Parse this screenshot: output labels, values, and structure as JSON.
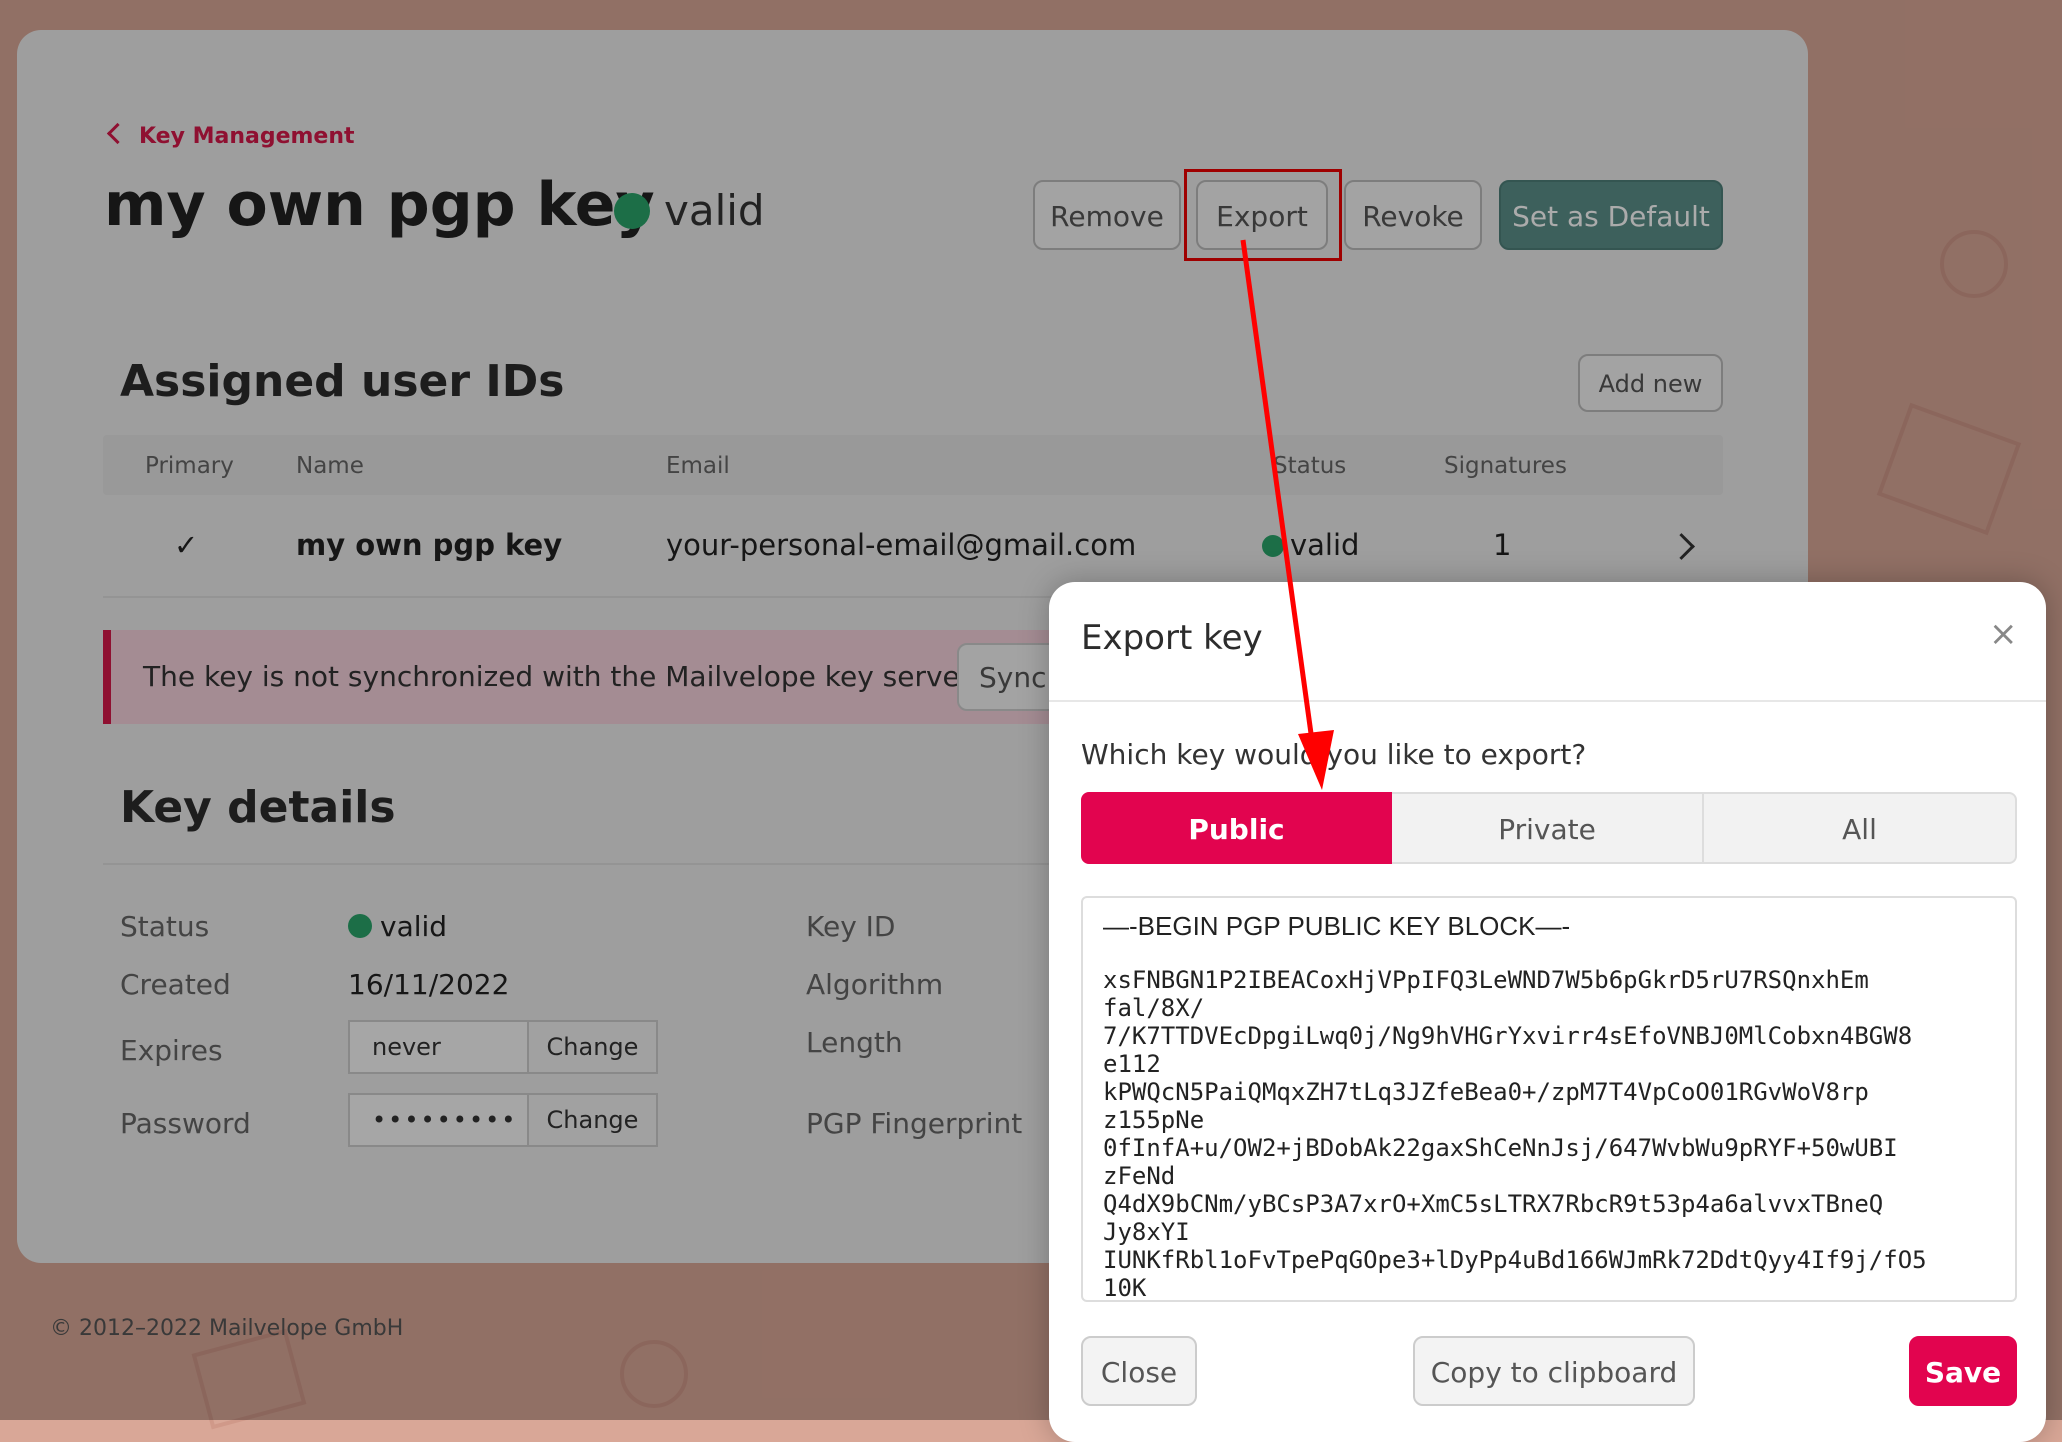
{
  "colors": {
    "accent": "#e2044f",
    "valid": "#2aa56b",
    "primary_button": "#5b8f8a",
    "annotation": "#ff0000"
  },
  "header": {
    "back_label": "Key Management",
    "title": "my own pgp key",
    "status": "valid"
  },
  "toolbar": {
    "remove": "Remove",
    "export": "Export",
    "revoke": "Revoke",
    "set_default": "Set as Default"
  },
  "user_ids": {
    "heading": "Assigned user IDs",
    "add_new": "Add new",
    "columns": [
      "Primary",
      "Name",
      "Email",
      "Status",
      "Signatures"
    ],
    "rows": [
      {
        "primary": "✓",
        "name": "my own pgp key",
        "email": "your-personal-email@gmail.com",
        "status": "valid",
        "signatures": "1"
      }
    ]
  },
  "alert": {
    "text": "The key is not synchronized with the Mailvelope key server.",
    "button": "Synch"
  },
  "details": {
    "heading": "Key details",
    "status_label": "Status",
    "status_value": "valid",
    "created_label": "Created",
    "created_value": "16/11/2022",
    "expires_label": "Expires",
    "expires_value": "never",
    "expires_change": "Change",
    "password_label": "Password",
    "password_value": "•••••••••",
    "password_change": "Change",
    "keyid_label": "Key ID",
    "algorithm_label": "Algorithm",
    "length_label": "Length",
    "fingerprint_label": "PGP Fingerprint"
  },
  "footer": {
    "copyright": "© 2012–2022  Mailvelope GmbH"
  },
  "modal": {
    "title": "Export key",
    "close_icon": "×",
    "question": "Which key would you like to export?",
    "options": [
      "Public",
      "Private",
      "All"
    ],
    "selected": "Public",
    "key_begin": "—-BEGIN PGP PUBLIC KEY BLOCK—-",
    "key_lines": [
      "xsFNBGN1P2IBEACoxHjVPpIFQ3LeWND7W5b6pGkrD5rU7RSQnxhEm",
      "fal/8X/",
      "7/K7TTDVEcDpgiLwq0j/Ng9hVHGrYxvirr4sEfoVNBJ0MlCobxn4BGW8",
      "e112",
      "kPWQcN5PaiQMqxZH7tLq3JZfeBea0+/zpM7T4VpCoO01RGvWoV8rp",
      "z155pNe",
      "0fInfA+u/OW2+jBDobAk22gaxShCeNnJsj/647WvbWu9pRYF+50wUBI",
      "zFeNd",
      "Q4dX9bCNm/yBCsP3A7xrO+XmC5sLTRX7RbcR9t53p4a6alvvxTBneQ",
      "Jy8xYI",
      "IUNKfRbl1oFvTpePqGOpe3+lDyPp4uBd166WJmRk72DdtQyy4If9j/fO5",
      "10K"
    ],
    "close_button": "Close",
    "copy_button": "Copy to clipboard",
    "save_button": "Save"
  }
}
